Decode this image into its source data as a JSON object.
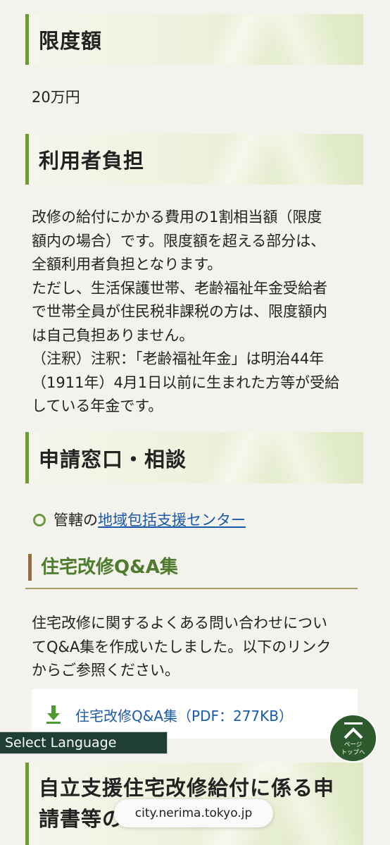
{
  "sections": {
    "limit": {
      "heading": "限度額",
      "body": "20万円"
    },
    "burden": {
      "heading": "利用者負担",
      "lines": [
        "改修の給付にかかる費用の1割相当額（限度",
        "額内の場合）です。限度額を超える部分は、",
        "全額利用者負担となります。",
        "ただし、生活保護世帯、老齢福祉年金受給者",
        "で世帯全員が住民税非課税の方は、限度額内",
        "は自己負担ありません。",
        "（注釈）注釈：「老齢福祉年金」は明治44年",
        "（1911年）4月1日以前に生まれた方等が受給",
        "している年金です。"
      ]
    },
    "contact": {
      "heading": "申請窓口・相談",
      "item_prefix": "管轄の",
      "item_link": "地域包括支援センター"
    },
    "qa": {
      "heading": "住宅改修Q&A集",
      "lines": [
        "住宅改修に関するよくある問い合わせについ",
        "てQ&A集を作成いたしました。以下のリンク",
        "からご参照ください。"
      ],
      "download_link": "住宅改修Q&A集（PDF：277KB）"
    },
    "forms": {
      "heading_line1": "自立支援住宅改修給付に係る申",
      "heading_line2": "請書等の"
    }
  },
  "language_selector": "Select Language",
  "page_top": {
    "line1": "ページ",
    "line2": "トップへ"
  },
  "browser": {
    "url": "city.nerima.tokyo.jp"
  },
  "colors": {
    "accent_green": "#6e9a3e",
    "heading_green": "#4c7c2c",
    "link_blue": "#1a5aa8",
    "pagetop_bg": "#2d5a2c",
    "lang_bg": "#1f3f34"
  }
}
